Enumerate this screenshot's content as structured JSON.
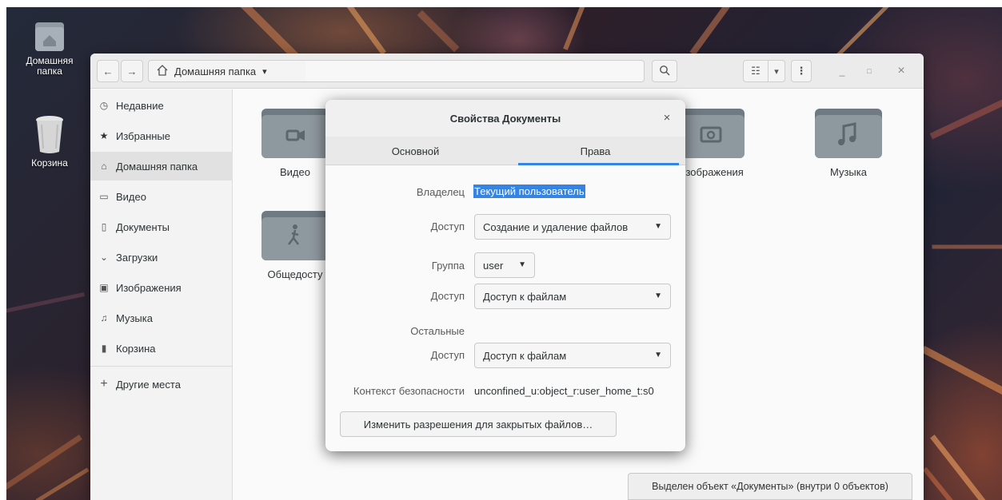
{
  "desktop": {
    "icons": [
      {
        "label": "Домашняя папка",
        "icon": "home-folder-icon"
      },
      {
        "label": "Корзина",
        "icon": "trash-icon"
      }
    ]
  },
  "window": {
    "nav": {
      "back": "←",
      "forward": "→"
    },
    "path": {
      "label": "Домашняя папка",
      "icon": "home-icon",
      "dropdown": "▾"
    },
    "search_icon": "⌕",
    "view_list_icon": "☷",
    "view_dropdown": "▾",
    "menu_icon": "⋮",
    "controls": {
      "minimize": "_",
      "maximize": "□",
      "close": "×"
    }
  },
  "sidebar": {
    "items": [
      {
        "label": "Недавние",
        "icon": "◷"
      },
      {
        "label": "Избранные",
        "icon": "★"
      },
      {
        "label": "Домашняя папка",
        "icon": "⌂"
      },
      {
        "label": "Видео",
        "icon": "▭"
      },
      {
        "label": "Документы",
        "icon": "▯"
      },
      {
        "label": "Загрузки",
        "icon": "⌄"
      },
      {
        "label": "Изображения",
        "icon": "▣"
      },
      {
        "label": "Музыка",
        "icon": "♫"
      },
      {
        "label": "Корзина",
        "icon": "▮"
      }
    ],
    "other_places": {
      "label": "Другие места",
      "icon": "+"
    }
  },
  "content": {
    "folders": [
      {
        "label": "Видео",
        "icon": "video-folder-icon"
      },
      {
        "label": "Изображения",
        "icon": "pictures-folder-icon"
      },
      {
        "label": "Музыка",
        "icon": "music-folder-icon"
      },
      {
        "label": "Общедосту",
        "icon": "public-folder-icon"
      }
    ]
  },
  "status": {
    "text": "Выделен объект «Документы» (внутри 0 объектов)"
  },
  "dialog": {
    "title": "Свойства Документы",
    "close": "×",
    "tabs": [
      "Основной",
      "Права"
    ],
    "active_tab": "Права",
    "owner": {
      "label": "Владелец",
      "value": "Текущий пользователь"
    },
    "owner_access": {
      "label": "Доступ",
      "value": "Создание и удаление файлов"
    },
    "group": {
      "label": "Группа",
      "value": "user"
    },
    "group_access": {
      "label": "Доступ",
      "value": "Доступ к файлам"
    },
    "others": {
      "label": "Остальные"
    },
    "others_access": {
      "label": "Доступ",
      "value": "Доступ к файлам"
    },
    "security_context": {
      "label": "Контекст безопасности",
      "value": "unconfined_u:object_r:user_home_t:s0"
    },
    "change_button": "Изменить разрешения для закрытых файлов…",
    "accent_color": "#3584e4"
  }
}
